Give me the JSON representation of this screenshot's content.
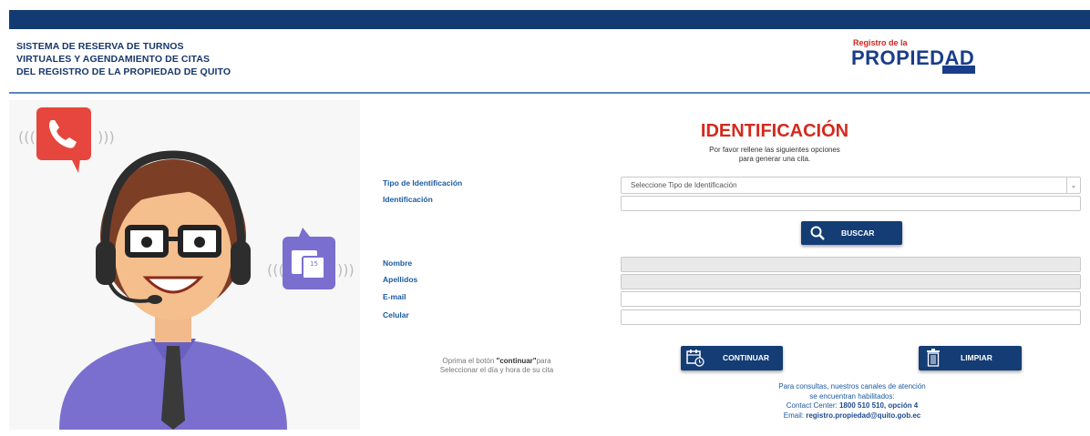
{
  "header": {
    "title_lines": [
      "SISTEMA DE RESERVA DE TURNOS",
      "VIRTUALES Y AGENDAMIENTO DE CITAS",
      "DEL REGISTRO DE LA PROPIEDAD DE QUITO"
    ],
    "logo_small": "Registro de la",
    "logo_big": "PROPIEDAD",
    "brand_color": "#133a73"
  },
  "illustration": {
    "calendar_number": "15"
  },
  "form": {
    "title": "IDENTIFICACIÓN",
    "subtitle_lines": [
      "Por favor rellene las siguientes opciones",
      "para generar una cita."
    ],
    "labels": {
      "tipo": "Tipo de Identificación",
      "identificacion": "Identificación",
      "nombre": "Nombre",
      "apellidos": "Apellidos",
      "email": "E-mail",
      "celular": "Celular"
    },
    "tipo_select": {
      "selected": "Seleccione Tipo de Identificación"
    },
    "buttons": {
      "buscar": "BUSCAR",
      "continuar": "CONTINUAR",
      "limpiar": "LIMPIAR"
    }
  },
  "hint": {
    "prefix": "Oprima el botón ",
    "bold": "\"continuar\"",
    "suffix": "para",
    "line2": "Seleccionar el día y hora de su cita"
  },
  "contact": {
    "line1": "Para consultas, nuestros canales de atención",
    "line2": "se encuentran habilitados:",
    "center_prefix": "Contact Center: ",
    "center_value": "1800 510 510, opción 4",
    "email_prefix": "Email: ",
    "email_value": "registro.propiedad@quito.gob.ec"
  }
}
